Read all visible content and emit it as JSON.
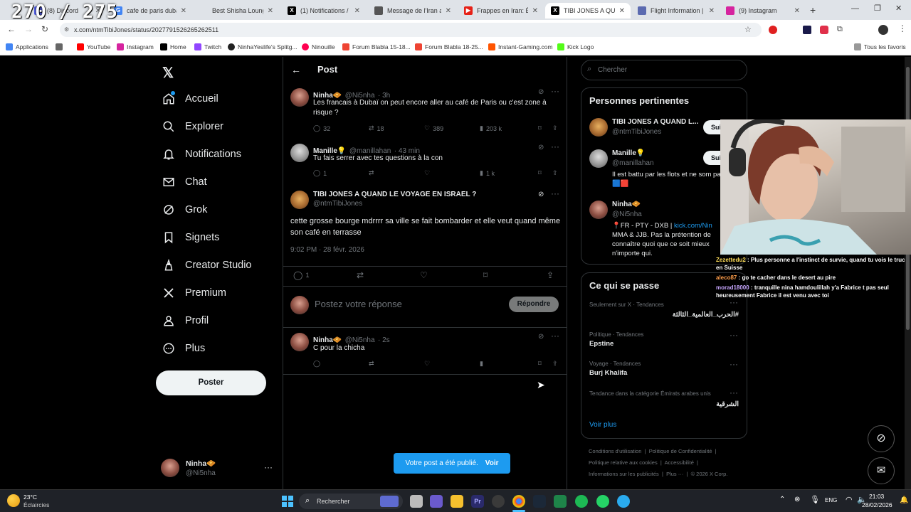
{
  "overlay": {
    "counter": "270 / 275"
  },
  "tabs": [
    {
      "label": "(8) Discord",
      "color": "#5865f2",
      "icon": "discord-icon"
    },
    {
      "label": "cafe de paris dubai u",
      "color": "#4285f4",
      "icon": "google-icon"
    },
    {
      "label": "Best Shisha Lounge in",
      "color": "#888888",
      "icon": "web-icon"
    },
    {
      "label": "(1) Notifications / X",
      "color": "#000000",
      "icon": "x-icon"
    },
    {
      "label": "Message de l'Iran au",
      "color": "#555555",
      "icon": "news-icon"
    },
    {
      "label": "Frappes en Iran: Ém",
      "color": "#e62117",
      "icon": "youtube-icon"
    },
    {
      "label": "TIBI JONES A QUAND",
      "color": "#000000",
      "icon": "x-icon"
    },
    {
      "label": "Flight Information | D",
      "color": "#5b6ab0",
      "icon": "plane-icon"
    },
    {
      "label": "(9) Instagram",
      "color": "#d6249f",
      "icon": "instagram-icon"
    }
  ],
  "address": {
    "url": "x.com/ntmTibiJones/status/2027791526265262511"
  },
  "bookmarks": [
    {
      "label": "Applications",
      "color": "#4285f4"
    },
    {
      "label": "",
      "color": "#666666"
    },
    {
      "label": "YouTube",
      "color": "#ff0000"
    },
    {
      "label": "Instagram",
      "color": "#d6249f"
    },
    {
      "label": "Home",
      "color": "#000000"
    },
    {
      "label": "Twitch",
      "color": "#9146ff"
    },
    {
      "label": "NinhaYeslife's Splitg...",
      "color": "#222222"
    },
    {
      "label": "Ninouille",
      "color": "#ff0050"
    },
    {
      "label": "Forum Blabla 15-18...",
      "color": "#e43"
    },
    {
      "label": "Forum Blabla 18-25...",
      "color": "#e43"
    },
    {
      "label": "Instant-Gaming.com",
      "color": "#ff5400"
    },
    {
      "label": "Kick Logo",
      "color": "#53fc18"
    }
  ],
  "bookmarks_right": "Tous les favoris",
  "nav": {
    "home": "Accueil",
    "explore": "Explorer",
    "notifications": "Notifications",
    "chat": "Chat",
    "grok": "Grok",
    "bookmarks": "Signets",
    "creator": "Creator Studio",
    "premium": "Premium",
    "profile": "Profil",
    "more": "Plus",
    "post_button": "Poster",
    "account": {
      "name": "Ninha🧇",
      "handle": "@Ni5nha"
    }
  },
  "header": {
    "title": "Post"
  },
  "thread": [
    {
      "name": "Ninha🧇",
      "handle": "@Ni5nha",
      "time": "· 3h",
      "text": "Les francais à Dubaï on peut encore aller au café de Paris ou c'est zone à risque ?",
      "replies": "32",
      "reposts": "18",
      "likes": "389",
      "views": "203 k"
    },
    {
      "name": "Manille💡",
      "handle": "@manillahan",
      "time": "· 43 min",
      "text": "Tu fais serrer avec tes questions à la con",
      "replies": "1",
      "reposts": "",
      "likes": "",
      "views": "1 k"
    }
  ],
  "main_post": {
    "name": "TIBI JONES A QUAND LE VOYAGE EN ISRAEL ?",
    "handle": "@ntmTibiJones",
    "text": "cette grosse bourge mdrrrr sa ville se fait bombarder et elle veut quand même son café en terrasse",
    "timestamp": "9:02 PM · 28 févr. 2026",
    "replies": "1"
  },
  "composer": {
    "placeholder": "Postez votre réponse",
    "button": "Répondre"
  },
  "reply": {
    "name": "Ninha🧇",
    "handle": "@Ni5nha",
    "time": "· 2s",
    "text": "C pour la chicha"
  },
  "search": {
    "placeholder": "Chercher"
  },
  "relevant": {
    "title": "Personnes pertinentes",
    "people": [
      {
        "name": "TIBI JONES A QUAND L...",
        "handle": "@ntmTibiJones",
        "follow": "Sui",
        "bio": ""
      },
      {
        "name": "Manille💡",
        "handle": "@manillahan",
        "follow": "Sui",
        "bio": "Il est battu par les flots et ne som pas. 🟦🟥"
      },
      {
        "name": "Ninha🧇",
        "handle": "@Ni5nha",
        "follow": "",
        "bio_prefix": "📍FR - PTY - DXB | ",
        "bio_link": "kick.com/Nin",
        "bio": "MMA & JJB. Pas la prétention de connaître quoi que ce soit mieux n'importe qui."
      }
    ]
  },
  "trends": {
    "title": "Ce qui se passe",
    "items": [
      {
        "meta": "Seulement sur X · Tendances",
        "name": "#الحرب_العالمية_الثالثة"
      },
      {
        "meta": "Politique · Tendances",
        "name": "Epstine"
      },
      {
        "meta": "Voyage · Tendances",
        "name": "Burj Khalifa"
      },
      {
        "meta": "Tendance dans la catégorie Émirats arabes unis",
        "name": "الشرقية"
      }
    ],
    "more": "Voir plus"
  },
  "footer": {
    "l1a": "Conditions d'utilisation",
    "l1b": "Politique de Confidentialité",
    "l2a": "Politique relative aux cookies",
    "l2b": "Accessibilité",
    "l3a": "Informations sur les publicités",
    "l3b": "Plus ···",
    "l3c": "© 2026 X Corp."
  },
  "toast": {
    "text": "Votre post a été publié.",
    "action": "Voir"
  },
  "stream_chat": [
    {
      "user": "Zezettedu2",
      "msg": " : Plus personne a l'instinct de survie, quand tu vois le truc en Suisse"
    },
    {
      "user": "aleco87",
      "msg": " : go te cacher dans le desert au pire"
    },
    {
      "user": "morad18000",
      "msg": " : tranquille nina hamdoulillah y'a Fabrice t pas seul heureusement Fabrice il est venu avec toi"
    }
  ],
  "taskbar": {
    "weather_temp": "23°C",
    "weather_desc": "Éclaircies",
    "search": "Rechercher",
    "lang": "ENG",
    "time": "21:03",
    "date": "28/02/2026"
  }
}
